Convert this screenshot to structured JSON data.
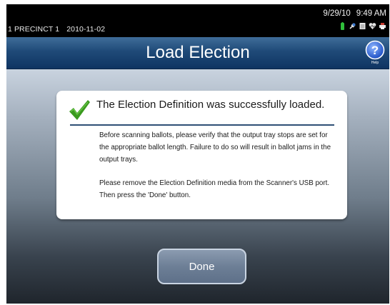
{
  "status_bar": {
    "precinct": "1 PRECINCT 1",
    "election_date": "2010-11-02",
    "date": "9/29/10",
    "time": "9:49 AM",
    "icons": [
      "battery-icon",
      "plug-icon",
      "document-icon",
      "heart-icon",
      "printer-icon"
    ]
  },
  "header": {
    "title": "Load Election",
    "help_label": "Help"
  },
  "dialog": {
    "title": "The Election Definition was successfully loaded.",
    "paragraph1": "Before scanning ballots, please verify that the output tray stops are set for the appropriate ballot length.  Failure to do so will result in ballot jams in the output trays.",
    "paragraph2": "Please remove the Election Definition media from the Scanner's USB port.  Then press the 'Done' button."
  },
  "actions": {
    "done_label": "Done"
  },
  "colors": {
    "title_bar": "#1f4a78",
    "check": "#3a9a1e",
    "button": "#6d7f96",
    "divider": "#2e4f76"
  }
}
